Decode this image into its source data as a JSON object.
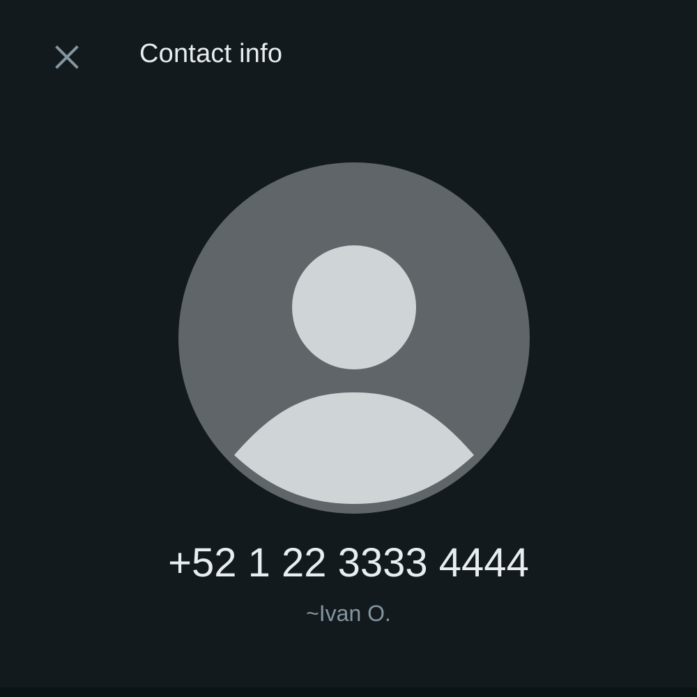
{
  "header": {
    "close_icon": "close-icon",
    "title": "Contact info"
  },
  "profile": {
    "avatar_icon": "default-user-avatar-icon",
    "phone_number": "+52 1 22 3333 4444",
    "push_name": "~Ivan O."
  },
  "colors": {
    "background": "#121a1e",
    "title_text": "#e9edef",
    "secondary_text": "#8696a0",
    "close_icon": "#8696a0",
    "avatar_background": "#5f6568",
    "avatar_figure": "#cfd4d6"
  }
}
